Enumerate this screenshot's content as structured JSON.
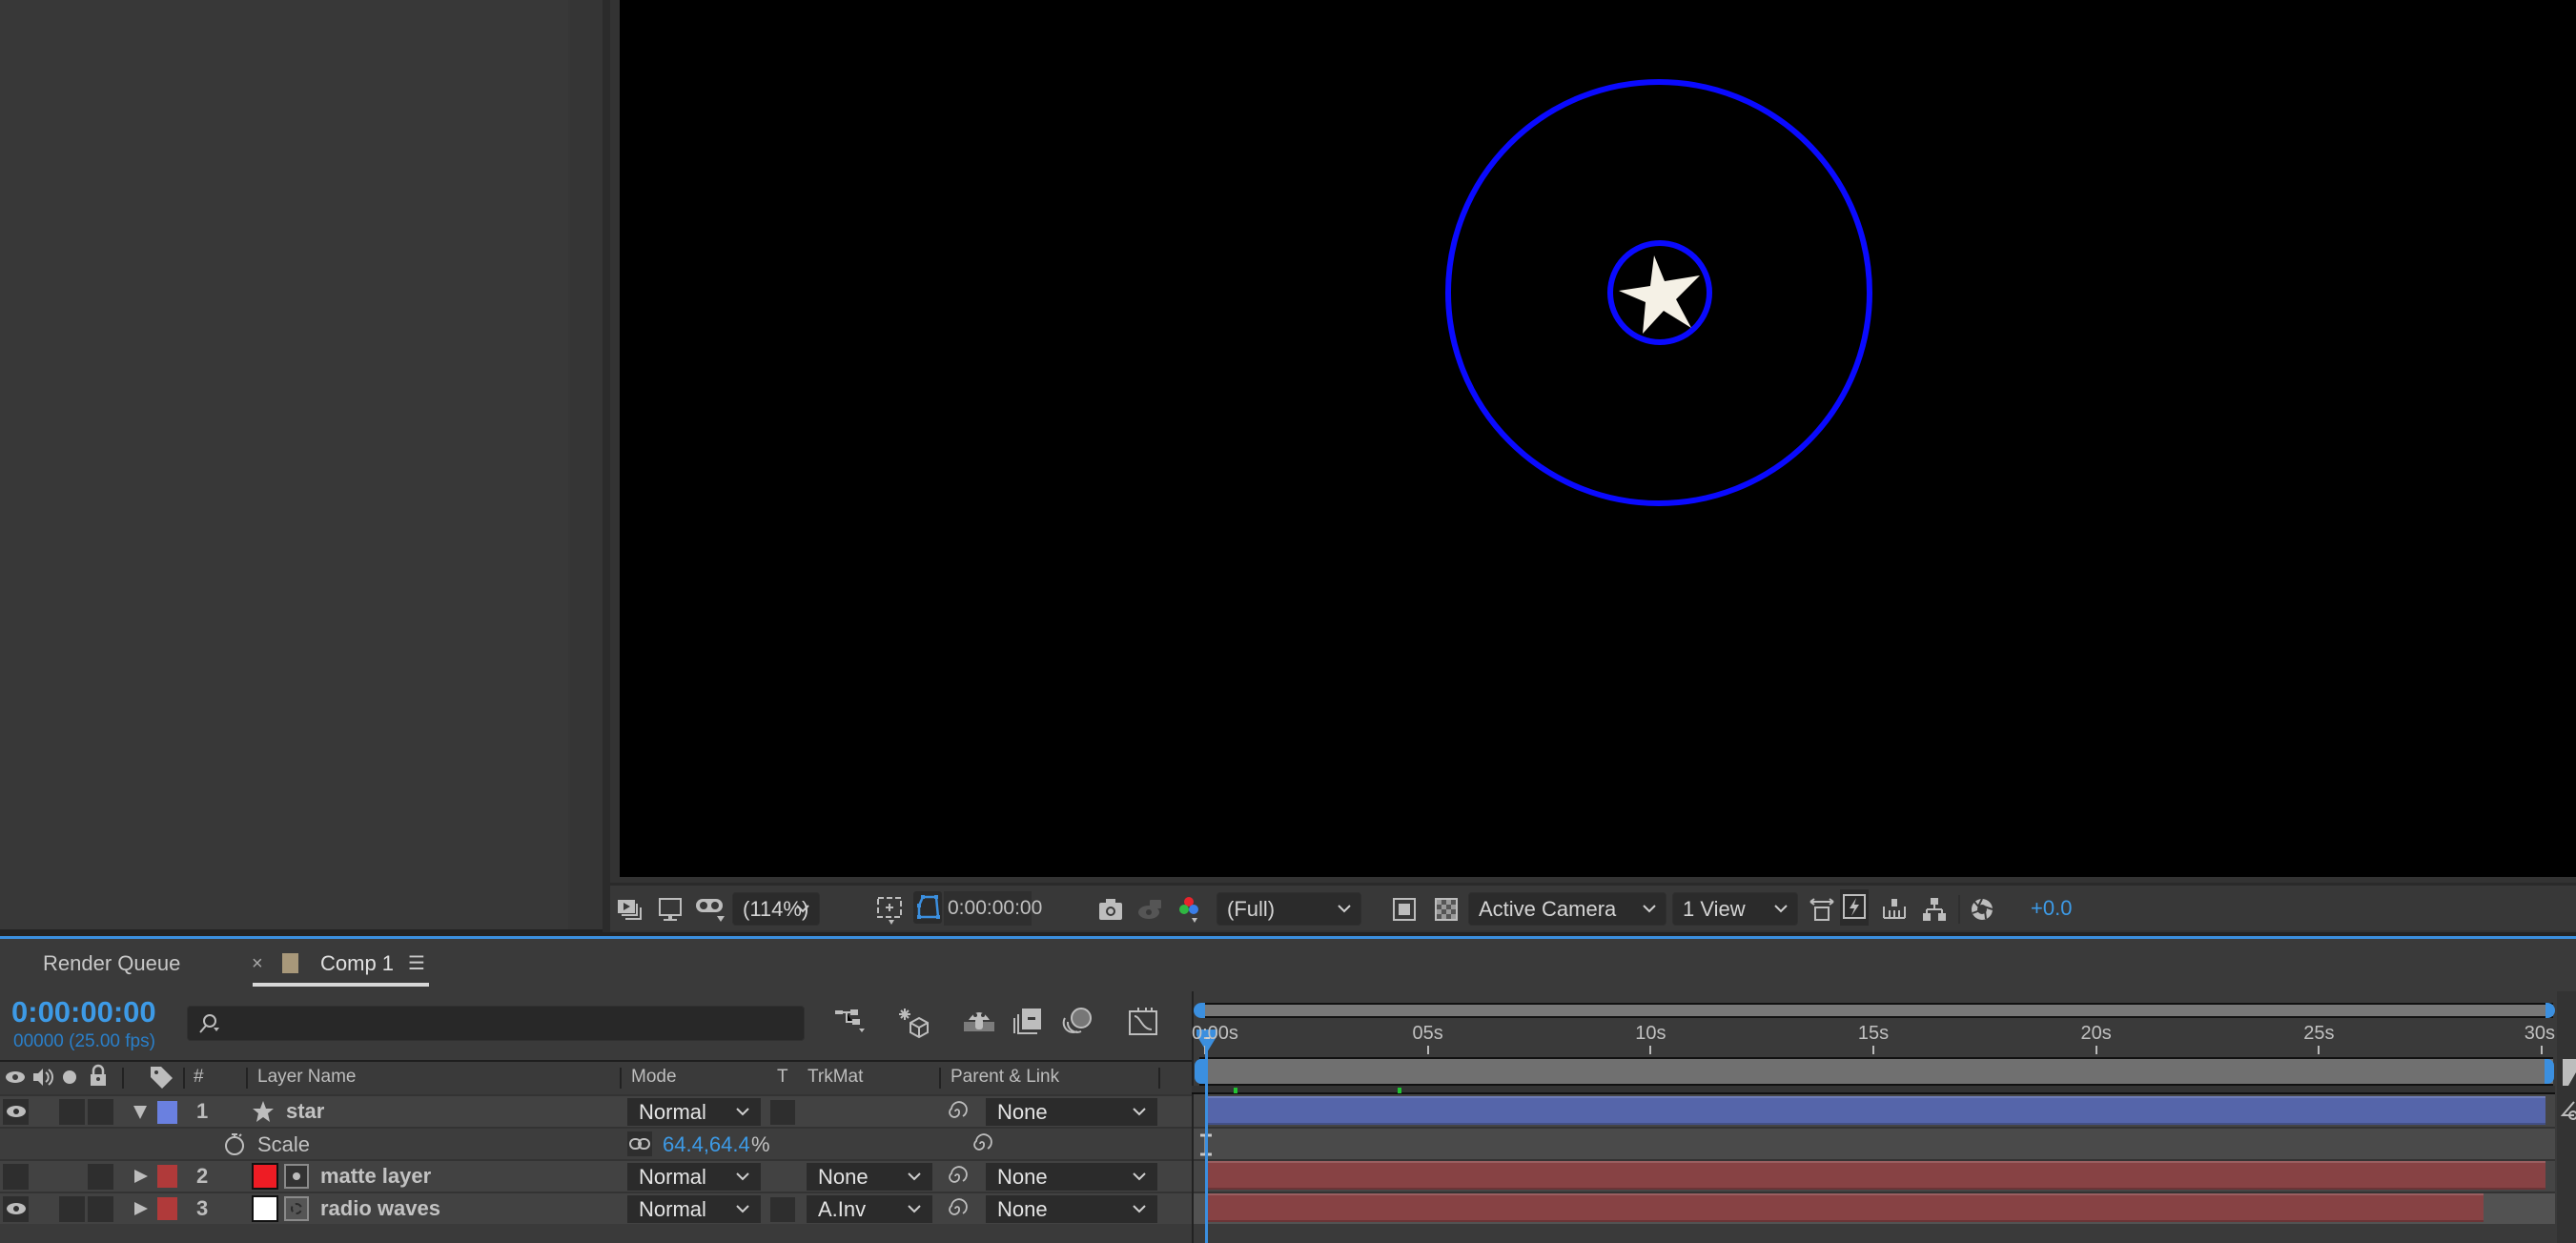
{
  "viewer": {
    "zoom_level": "(114%)",
    "current_time": "0:00:00:00",
    "resolution": "(Full)",
    "camera": "Active Camera",
    "views": "1 View",
    "exposure": "+0.0",
    "icons": [
      "always-preview-icon",
      "monitor-icon",
      "vr-goggles-icon",
      "region-of-interest-icon",
      "mask-path-visibility-icon",
      "snapshot-icon",
      "show-snapshot-icon",
      "rgb-channels-icon",
      "toggle-transparency-grid-icon",
      "checkerboard-icon",
      "3d-view-icon",
      "fast-previews-icon",
      "timeline-icon",
      "flowchart-icon",
      "reset-exposure-icon"
    ],
    "accent_color": "#3b8fdf",
    "composition": {
      "background": "#000000",
      "shapes": [
        "outer-ring",
        "inner-ring",
        "star"
      ],
      "ring_color": "#0a0aff",
      "star_color": "#f5f1e6"
    }
  },
  "tabs": {
    "render_queue": "Render Queue",
    "comp_close": "×",
    "comp": "Comp 1",
    "comp_menu": "☰",
    "comp_color": "#a8987a"
  },
  "timeline": {
    "timecode": "0:00:00:00",
    "frame_info": "00000 (25.00 fps)",
    "search_placeholder": "",
    "columns": {
      "number": "#",
      "layer_name": "Layer Name",
      "mode": "Mode",
      "t": "T",
      "trkmat": "TrkMat",
      "parent": "Parent & Link"
    },
    "ruler": {
      "labels": [
        "0:00s",
        "05s",
        "10s",
        "15s",
        "20s",
        "25s",
        "30s"
      ],
      "duration_seconds": 30
    },
    "layers": [
      {
        "num": "1",
        "name": "star",
        "type": "shape",
        "label_color": "#6a80e0",
        "visible": true,
        "expanded": true,
        "mode": "Normal",
        "trkmat": "",
        "parent": "None",
        "bar_color": "#5565aa",
        "in": 0,
        "out": 30,
        "property": {
          "name": "Scale",
          "value": "64.4,64.4",
          "unit": "%"
        }
      },
      {
        "num": "2",
        "name": "matte layer",
        "type": "solid",
        "label_color": "#b03a3a",
        "swatch_color": "#ee1c24",
        "visible": false,
        "expanded": false,
        "mode": "Normal",
        "trkmat": "None",
        "parent": "None",
        "bar_color": "#874244",
        "in": 0,
        "out": 30
      },
      {
        "num": "3",
        "name": "radio waves",
        "type": "precomp",
        "label_color": "#b03a3a",
        "swatch_color": "#ffffff",
        "visible": true,
        "expanded": false,
        "mode": "Normal",
        "trkmat": "A.Inv",
        "parent": "None",
        "bar_color": "#874244",
        "in": 0,
        "out": 28.6
      }
    ]
  }
}
